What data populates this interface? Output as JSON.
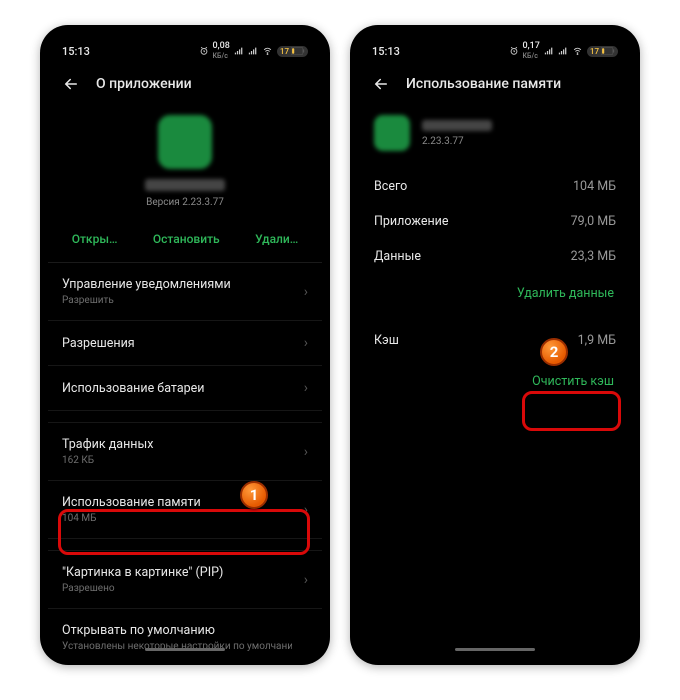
{
  "left": {
    "status": {
      "time": "15:13",
      "net": "0,08",
      "net_unit": "КБ/с",
      "battery": "17"
    },
    "header_title": "О приложении",
    "app": {
      "version_prefix": "Версия",
      "version": "2.23.3.77"
    },
    "actions": {
      "open": "Откры…",
      "stop": "Остановить",
      "uninstall": "Удали…"
    },
    "rows": {
      "notifications": {
        "label": "Управление уведомлениями",
        "sub": "Разрешить"
      },
      "permissions": {
        "label": "Разрешения"
      },
      "battery": {
        "label": "Использование батареи"
      },
      "traffic": {
        "label": "Трафик данных",
        "sub": "162 КБ"
      },
      "memory": {
        "label": "Использование памяти",
        "sub": "104 МБ"
      },
      "pip": {
        "label": "\"Картинка в картинке\" (PIP)",
        "sub": "Разрешено"
      },
      "defaults": {
        "label": "Открывать по умолчанию",
        "sub": "Установлены некоторые настройки по умолчанию"
      }
    }
  },
  "right": {
    "status": {
      "time": "15:13",
      "net": "0,17",
      "net_unit": "КБ/с",
      "battery": "17"
    },
    "header_title": "Использование памяти",
    "app": {
      "version": "2.23.3.77"
    },
    "kv": {
      "total": {
        "label": "Всего",
        "value": "104 МБ"
      },
      "app": {
        "label": "Приложение",
        "value": "79,0 МБ"
      },
      "data": {
        "label": "Данные",
        "value": "23,3 МБ"
      },
      "cache": {
        "label": "Кэш",
        "value": "1,9 МБ"
      }
    },
    "buttons": {
      "clear_data": "Удалить данные",
      "clear_cache": "Очистить кэш"
    }
  },
  "callouts": {
    "one": "1",
    "two": "2"
  }
}
